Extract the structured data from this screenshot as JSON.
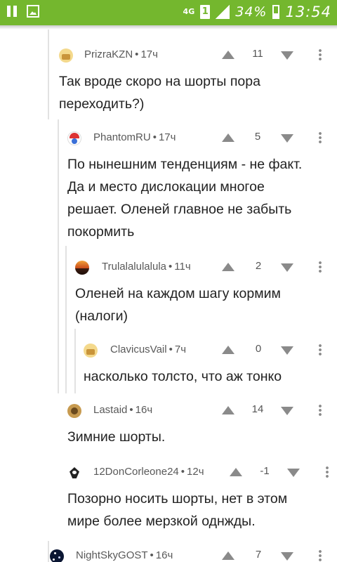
{
  "status_bar": {
    "network": "4G",
    "sim": "1",
    "battery": "34%",
    "time": "13:54"
  },
  "comments": [
    {
      "author": "PrizraKZN",
      "separator": "•",
      "time": "17ч",
      "rating": "11",
      "avatar_icon": "avatar-icon",
      "lines": [
        "Так вроде скоро на шорты пора",
        "переходить?)"
      ]
    },
    {
      "author": "PhantomRU",
      "separator": "•",
      "time": "17ч",
      "rating": "5",
      "avatar_icon": "avatar-icon",
      "lines": [
        "По нынешним тенденциям - не факт.",
        "Да и место дислокации многое",
        "решает. Оленей главное не забыть",
        "покормить"
      ]
    },
    {
      "author": "Trulalalulalula",
      "separator": "•",
      "time": "11ч",
      "rating": "2",
      "avatar_icon": "avatar-icon",
      "lines": [
        "Оленей на каждом шагу кормим",
        "(налоги)"
      ]
    },
    {
      "author": "ClavicusVail",
      "separator": "•",
      "time": "7ч",
      "rating": "0",
      "avatar_icon": "avatar-icon",
      "lines": [
        "насколько толсто, что аж тонко"
      ]
    },
    {
      "author": "Lastaid",
      "separator": "•",
      "time": "16ч",
      "rating": "14",
      "avatar_icon": "avatar-icon",
      "lines": [
        "Зимние шорты."
      ]
    },
    {
      "author": "12DonCorleone24",
      "separator": "•",
      "time": "12ч",
      "rating": "-1",
      "avatar_icon": "avatar-icon",
      "lines": [
        "Позорно носить шорты, нет в этом",
        "мире более мерзкой однжды."
      ]
    },
    {
      "author": "NightSkyGOST",
      "separator": "•",
      "time": "16ч",
      "rating": "7",
      "avatar_icon": "avatar-icon",
      "lines": []
    }
  ],
  "colors": {
    "status_bar": "#74b72e",
    "thread_line": "#e2e2e2",
    "meta_text": "#595959",
    "icon_grey": "#8a8a8a"
  }
}
